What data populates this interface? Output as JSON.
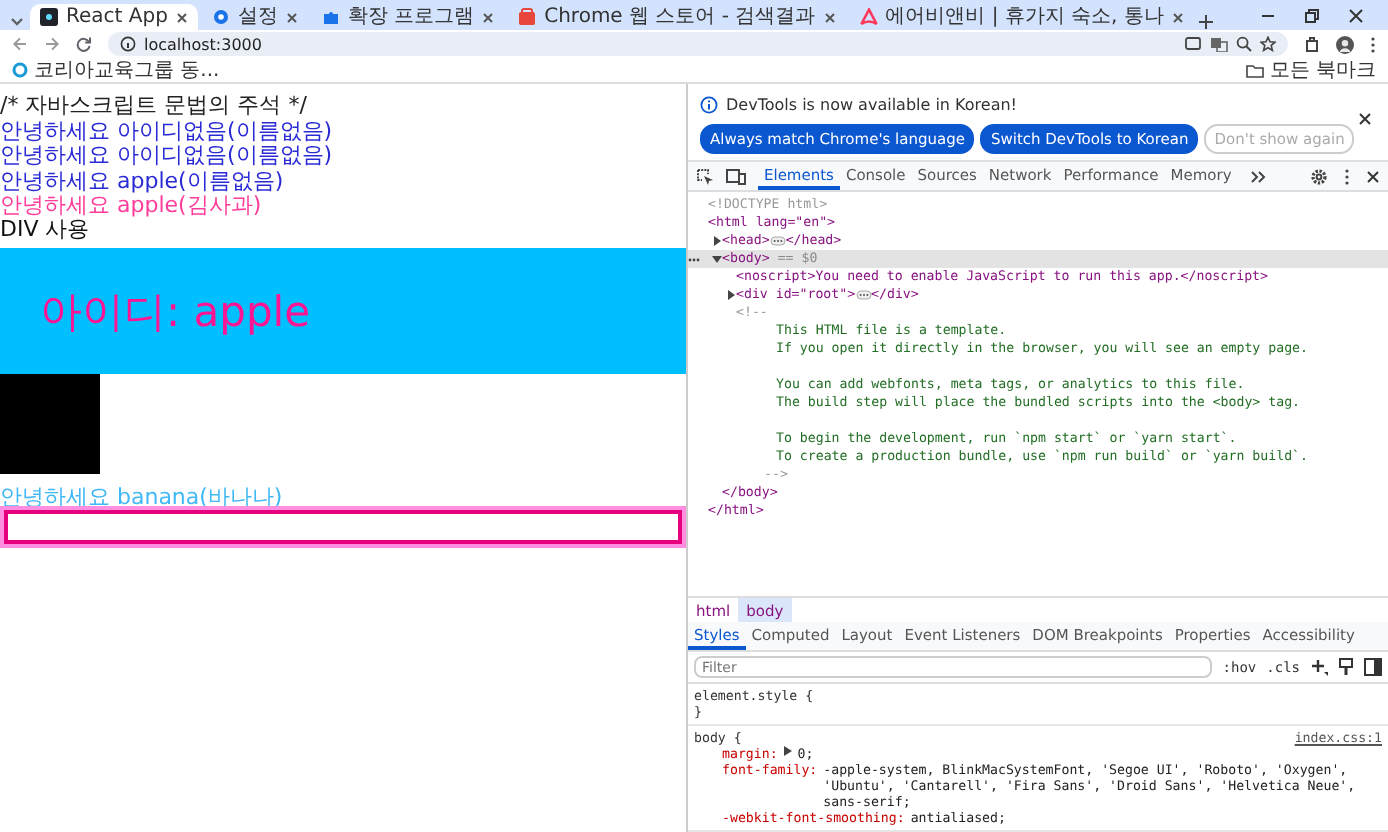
{
  "browser": {
    "tabs": [
      {
        "title": "React App",
        "selected": true
      },
      {
        "title": "설정",
        "selected": false
      },
      {
        "title": "확장 프로그램",
        "selected": false
      },
      {
        "title": "Chrome 웹 스토어 - 검색결과",
        "selected": false
      },
      {
        "title": "에어비앤비 | 휴가지 숙소, 통나",
        "selected": false
      }
    ],
    "address": "localhost:3000",
    "bookmarks": [
      "코리아교육그룹 동..."
    ],
    "all_bookmarks": "모든 북마크"
  },
  "page": {
    "lines": [
      {
        "text": "/* 자바스크립트 문법의 주석 */",
        "color": "#222222"
      },
      {
        "text": "안녕하세요 아이디없음(이름없음)",
        "color": "#2b2bd6"
      },
      {
        "text": "안녕하세요 아이디없음(이름없음)",
        "color": "#2b2bd6"
      },
      {
        "text": "안녕하세요 apple(이름없음)",
        "color": "#2b2bd6"
      },
      {
        "text": "안녕하세요 apple(김사과)",
        "color": "#ff3c9a"
      },
      {
        "text": "DIV 사용",
        "color": "#111111"
      }
    ],
    "id_box": "아이디: apple",
    "after_line": {
      "text": "안녕하세요 banana(바나나)",
      "color": "#3fb8f5"
    }
  },
  "devtools": {
    "notice": {
      "message": "DevTools is now available in Korean!",
      "buttons": [
        {
          "label": "Always match Chrome's language",
          "primary": true
        },
        {
          "label": "Switch DevTools to Korean",
          "primary": true
        },
        {
          "label": "Don't show again",
          "primary": false
        }
      ]
    },
    "panel_tabs": [
      {
        "label": "Elements",
        "selected": true
      },
      {
        "label": "Console",
        "selected": false
      },
      {
        "label": "Sources",
        "selected": false
      },
      {
        "label": "Network",
        "selected": false
      },
      {
        "label": "Performance",
        "selected": false
      },
      {
        "label": "Memory",
        "selected": false
      }
    ],
    "dom": [
      {
        "kind": "doctype",
        "open": "<!DOCTYPE html>"
      },
      {
        "kind": "element",
        "open": "<html lang=\"en\">",
        "close": "</html>",
        "children": [
          {
            "kind": "element",
            "open": "<head>",
            "close": "</head>",
            "expanded": false,
            "selected": false
          },
          {
            "kind": "element",
            "open": "<body>",
            "close": "</body>",
            "expanded": true,
            "selected": true,
            "note": "== $0",
            "children": [
              {
                "kind": "element",
                "open": "<noscript>You need to enable JavaScript to run this app.</noscript>"
              },
              {
                "kind": "element",
                "open": "<div id=\"root\">",
                "close": "</div>",
                "expanded": false,
                "selected": false
              },
              {
                "kind": "comment",
                "open": "<!--",
                "close": "-->",
                "paragraphs": [
                  [
                    "This HTML file is a template.",
                    "If you open it directly in the browser, you will see an empty page."
                  ],
                  [
                    "You can add webfonts, meta tags, or analytics to this file.",
                    "The build step will place the bundled scripts into the <body> tag."
                  ],
                  [
                    "To begin the development, run `npm start` or `yarn start`.",
                    "To create a production bundle, use `npm run build` or `yarn build`."
                  ]
                ]
              }
            ]
          }
        ]
      }
    ],
    "breadcrumb": [
      {
        "label": "html",
        "selected": false
      },
      {
        "label": "body",
        "selected": true
      }
    ],
    "style_tabs": [
      {
        "label": "Styles",
        "selected": true
      },
      {
        "label": "Computed",
        "selected": false
      },
      {
        "label": "Layout",
        "selected": false
      },
      {
        "label": "Event Listeners",
        "selected": false
      },
      {
        "label": "DOM Breakpoints",
        "selected": false
      },
      {
        "label": "Properties",
        "selected": false
      },
      {
        "label": "Accessibility",
        "selected": false
      }
    ],
    "filter": {
      "placeholder": "Filter"
    },
    "filter_buttons": [
      ":hov",
      ".cls"
    ],
    "rules": [
      {
        "selector": "element.style {",
        "close": "}"
      },
      {
        "selector": "body {",
        "source": "index.css:1",
        "props": [
          {
            "name": "margin:",
            "value": "0;",
            "expandable": true
          },
          {
            "name": "font-family:",
            "value": "-apple-system, BlinkMacSystemFont, 'Segoe UI', 'Roboto', 'Oxygen', 'Ubuntu', 'Cantarell', 'Fira Sans', 'Droid Sans', 'Helvetica Neue', sans-serif;",
            "expandable": false
          },
          {
            "name": "-webkit-font-smoothing:",
            "value": "antialiased;",
            "expandable": false
          }
        ]
      }
    ]
  }
}
